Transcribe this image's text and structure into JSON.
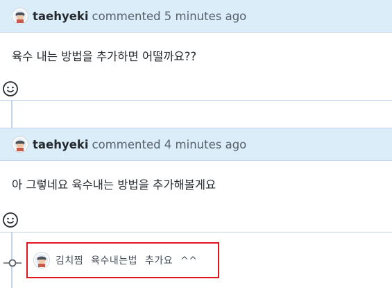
{
  "comments": [
    {
      "author": "taehyeki",
      "meta": "commented 5 minutes ago",
      "body": "육수 내는 방법을 추가하면 어떨까요??"
    },
    {
      "author": "taehyeki",
      "meta": "commented 4 minutes ago",
      "body": "아 그렇네요 육수내는 방법을 추가해볼게요"
    }
  ],
  "commit_event": {
    "message": "김치찜 육수내는법 추가요 ^^"
  },
  "icons": {
    "avatar": "user-avatar-icon",
    "reaction": "smiley-icon",
    "commit": "git-commit-icon"
  },
  "colors": {
    "header_bg": "#dbedf9",
    "border": "#c0d3eb",
    "highlight": "#e0141e"
  }
}
